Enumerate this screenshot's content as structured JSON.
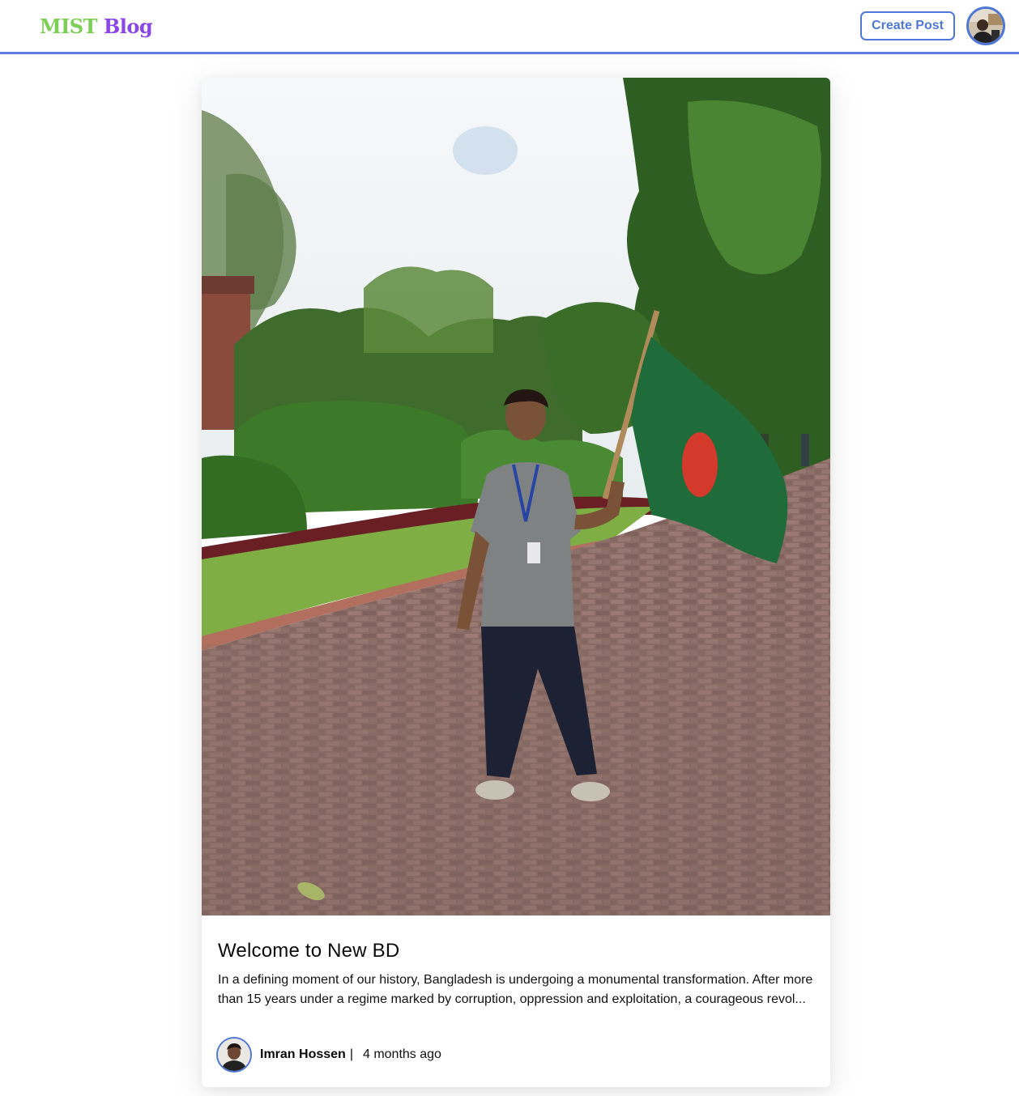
{
  "header": {
    "brand_part1": "MIST",
    "brand_part2": "Blog",
    "create_post_label": "Create Post",
    "accent_color": "#4f77d6",
    "brand_colors": [
      "#7ccf55",
      "#8a46e6"
    ]
  },
  "post": {
    "title": "Welcome to New BD",
    "excerpt": "In a defining moment of our history, Bangladesh is undergoing a monumental transformation. After more than 15 years under a regime marked by corruption, oppression and exploitation, a courageous revol...",
    "author_name": "Imran Hossen",
    "separator": "|",
    "time_ago": "4 months ago"
  }
}
